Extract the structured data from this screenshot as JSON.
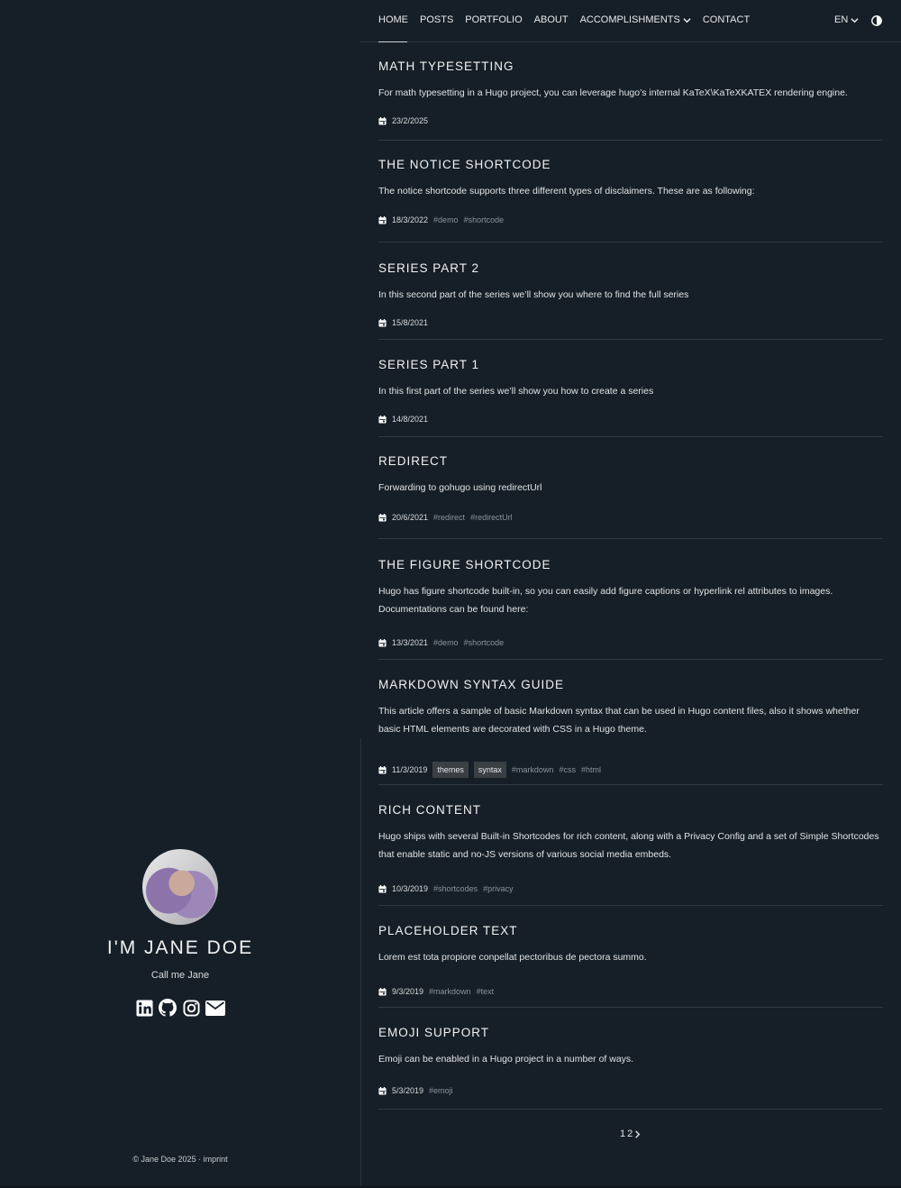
{
  "nav": {
    "items": [
      "HOME",
      "POSTS",
      "PORTFOLIO",
      "ABOUT",
      "ACCOMPLISHMENTS",
      "CONTACT"
    ],
    "lang": "EN"
  },
  "profile": {
    "name": "I'M JANE DOE",
    "tagline": "Call me Jane",
    "socials": [
      "linkedin-icon",
      "github-icon",
      "instagram-icon",
      "email-icon"
    ]
  },
  "footer": {
    "text": "© Jane Doe 2025 · ",
    "link": "imprint"
  },
  "posts": [
    {
      "title": "MATH TYPESETTING",
      "excerpt": "For math typesetting in a Hugo project, you can leverage hugo’s internal KaTeX\\KaTeXKATEX rendering engine.",
      "date": "23/2/2025",
      "categories": [],
      "tags": []
    },
    {
      "title": "THE NOTICE SHORTCODE",
      "excerpt": "The notice shortcode supports three different types of disclaimers. These are as following:",
      "date": "18/3/2022",
      "categories": [],
      "tags": [
        "#demo",
        "#shortcode"
      ]
    },
    {
      "title": "SERIES PART 2",
      "excerpt": "In this second part of the series we’ll show you where to find the full series",
      "date": "15/8/2021",
      "categories": [],
      "tags": []
    },
    {
      "title": "SERIES PART 1",
      "excerpt": "In this first part of the series we’ll show you how to create a series",
      "date": "14/8/2021",
      "categories": [],
      "tags": []
    },
    {
      "title": "REDIRECT",
      "excerpt": "Forwarding to gohugo using redirectUrl",
      "date": "20/6/2021",
      "categories": [],
      "tags": [
        "#redirect",
        "#redirectUrl"
      ]
    },
    {
      "title": "THE FIGURE SHORTCODE",
      "excerpt": "Hugo has figure shortcode built-in, so you can easily add figure captions or hyperlink rel attributes to images. Documentations can be found here:",
      "date": "13/3/2021",
      "categories": [],
      "tags": [
        "#demo",
        "#shortcode"
      ]
    },
    {
      "title": "MARKDOWN SYNTAX GUIDE",
      "excerpt": "This article offers a sample of basic Markdown syntax that can be used in Hugo content files, also it shows whether basic HTML elements are decorated with CSS in a Hugo theme.",
      "date": "11/3/2019",
      "categories": [
        "themes",
        "syntax"
      ],
      "tags": [
        "#markdown",
        "#css",
        "#html"
      ]
    },
    {
      "title": "RICH CONTENT",
      "excerpt": "Hugo ships with several Built-in Shortcodes for rich content, along with a Privacy Config and a set of Simple Shortcodes that enable static and no-JS versions of various social media embeds.",
      "date": "10/3/2019",
      "categories": [],
      "tags": [
        "#shortcodes",
        "#privacy"
      ]
    },
    {
      "title": "PLACEHOLDER TEXT",
      "excerpt": "Lorem est tota propiore conpellat pectoribus de pectora summo.",
      "date": "9/3/2019",
      "categories": [],
      "tags": [
        "#markdown",
        "#text"
      ]
    },
    {
      "title": "EMOJI SUPPORT",
      "excerpt": "Emoji can be enabled in a Hugo project in a number of ways.",
      "date": "5/3/2019",
      "categories": [],
      "tags": [
        "#emoji"
      ]
    }
  ],
  "pagination": {
    "pages": [
      "1",
      "2"
    ]
  }
}
